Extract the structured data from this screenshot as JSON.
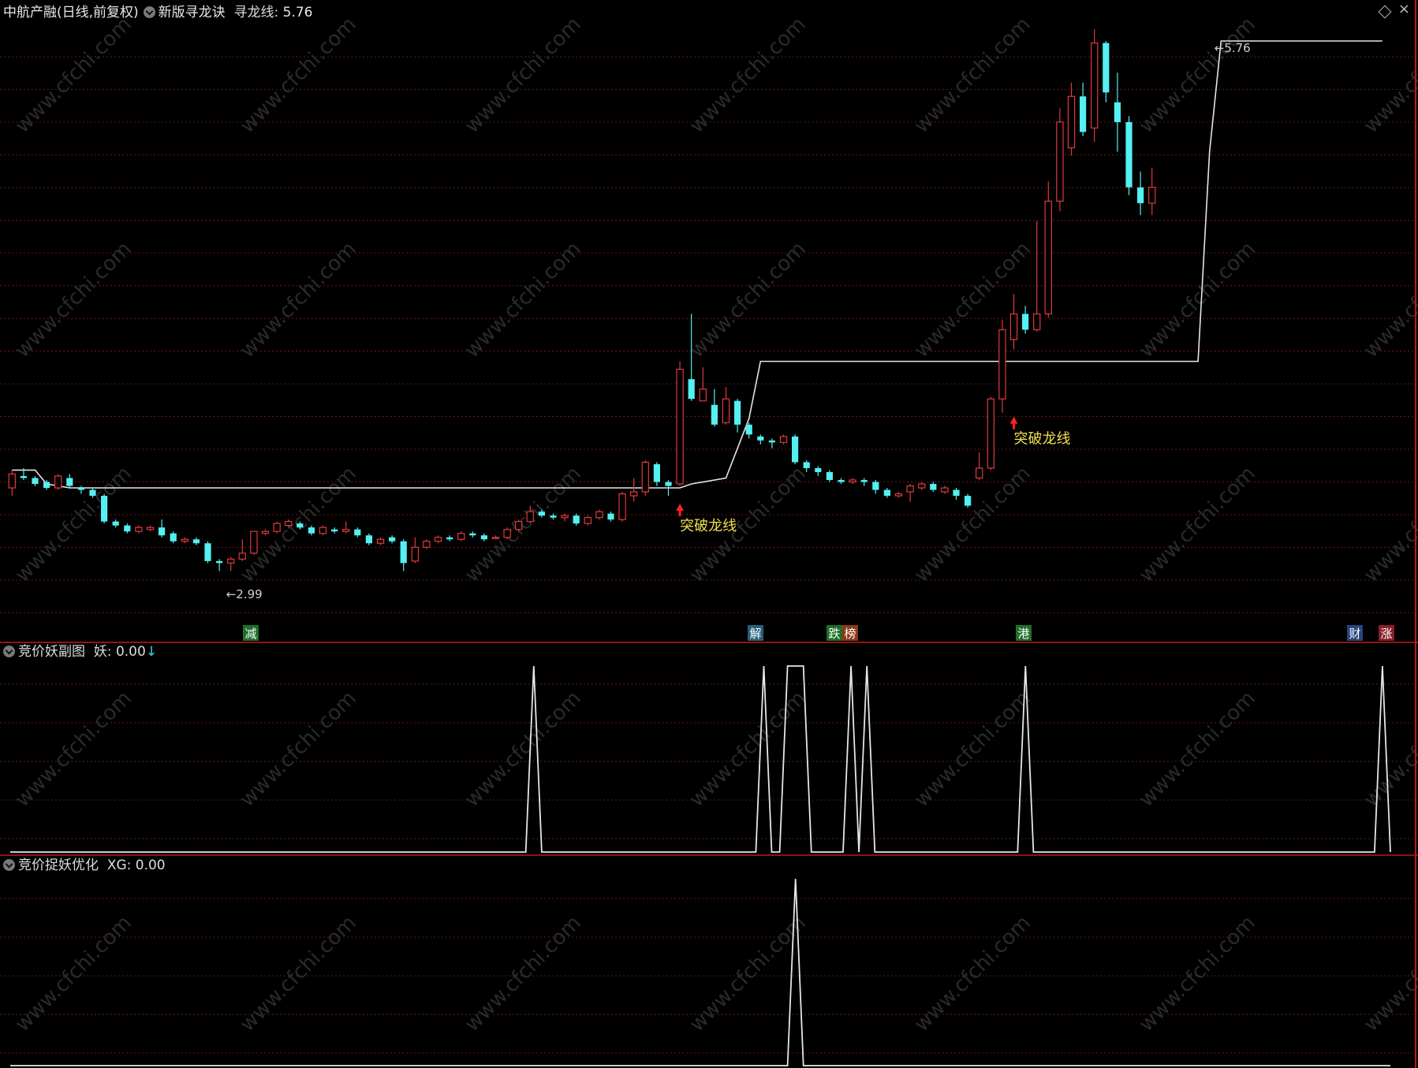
{
  "colors": {
    "background": "#000000",
    "up": "#e0393c",
    "down": "#54f0f2",
    "grid": "#6e1414",
    "border": "#c01818",
    "line": "#e6e6e6",
    "signal_text": "#f0e050",
    "signal_arrow": "#ff2020"
  },
  "main_panel": {
    "stock_title": "中航产融(日线,前复权)",
    "indicator_name": "新版寻龙诀",
    "line_label": "寻龙线:",
    "line_value": "5.76",
    "max_label": "5.76",
    "min_label": "2.99"
  },
  "sub_panel_1": {
    "name": "竞价妖副图",
    "value_label": "妖:",
    "value": "0.00"
  },
  "sub_panel_2": {
    "name": "竞价捉妖优化",
    "value_label": "XG:",
    "value": "0.00"
  },
  "icons": [
    "indicator-toggle-icon",
    "diamond-icon",
    "close-icon",
    "down-arrow-icon"
  ],
  "chart_data": {
    "type": "candlestick",
    "n": 120,
    "ylim": [
      2.95,
      5.8
    ],
    "candles": [
      [
        3.5,
        3.57,
        3.59,
        3.46
      ],
      [
        3.56,
        3.55,
        3.6,
        3.54
      ],
      [
        3.55,
        3.52,
        3.56,
        3.51
      ],
      [
        3.53,
        3.5,
        3.54,
        3.49
      ],
      [
        3.5,
        3.56,
        3.57,
        3.49
      ],
      [
        3.55,
        3.51,
        3.57,
        3.5
      ],
      [
        3.5,
        3.49,
        3.51,
        3.47
      ],
      [
        3.49,
        3.46,
        3.5,
        3.45
      ],
      [
        3.46,
        3.33,
        3.47,
        3.32
      ],
      [
        3.33,
        3.31,
        3.34,
        3.3
      ],
      [
        3.31,
        3.28,
        3.32,
        3.27
      ],
      [
        3.28,
        3.3,
        3.31,
        3.27
      ],
      [
        3.29,
        3.3,
        3.31,
        3.28
      ],
      [
        3.3,
        3.26,
        3.34,
        3.25
      ],
      [
        3.27,
        3.23,
        3.28,
        3.22
      ],
      [
        3.23,
        3.24,
        3.25,
        3.22
      ],
      [
        3.24,
        3.22,
        3.25,
        3.21
      ],
      [
        3.22,
        3.13,
        3.23,
        3.12
      ],
      [
        3.13,
        3.12,
        3.14,
        3.08
      ],
      [
        3.12,
        3.14,
        3.15,
        3.08
      ],
      [
        3.14,
        3.17,
        3.24,
        3.13
      ],
      [
        3.17,
        3.28,
        3.28,
        3.16
      ],
      [
        3.27,
        3.28,
        3.29,
        3.26
      ],
      [
        3.28,
        3.32,
        3.33,
        3.27
      ],
      [
        3.31,
        3.33,
        3.34,
        3.3
      ],
      [
        3.32,
        3.3,
        3.33,
        3.29
      ],
      [
        3.3,
        3.27,
        3.31,
        3.26
      ],
      [
        3.27,
        3.3,
        3.31,
        3.26
      ],
      [
        3.29,
        3.28,
        3.3,
        3.27
      ],
      [
        3.28,
        3.29,
        3.33,
        3.27
      ],
      [
        3.29,
        3.26,
        3.3,
        3.25
      ],
      [
        3.26,
        3.22,
        3.27,
        3.21
      ],
      [
        3.22,
        3.24,
        3.25,
        3.21
      ],
      [
        3.25,
        3.23,
        3.26,
        3.22
      ],
      [
        3.23,
        3.12,
        3.24,
        3.08
      ],
      [
        3.13,
        3.2,
        3.25,
        3.12
      ],
      [
        3.2,
        3.23,
        3.24,
        3.19
      ],
      [
        3.23,
        3.25,
        3.26,
        3.22
      ],
      [
        3.25,
        3.24,
        3.26,
        3.23
      ],
      [
        3.24,
        3.27,
        3.28,
        3.23
      ],
      [
        3.27,
        3.26,
        3.28,
        3.25
      ],
      [
        3.26,
        3.24,
        3.27,
        3.23
      ],
      [
        3.25,
        3.25,
        3.26,
        3.24
      ],
      [
        3.25,
        3.29,
        3.3,
        3.24
      ],
      [
        3.29,
        3.33,
        3.34,
        3.28
      ],
      [
        3.33,
        3.38,
        3.41,
        3.32
      ],
      [
        3.38,
        3.36,
        3.39,
        3.35
      ],
      [
        3.36,
        3.35,
        3.37,
        3.34
      ],
      [
        3.35,
        3.36,
        3.37,
        3.33
      ],
      [
        3.36,
        3.32,
        3.37,
        3.31
      ],
      [
        3.32,
        3.35,
        3.36,
        3.31
      ],
      [
        3.35,
        3.38,
        3.39,
        3.34
      ],
      [
        3.37,
        3.34,
        3.38,
        3.33
      ],
      [
        3.34,
        3.47,
        3.48,
        3.33
      ],
      [
        3.46,
        3.48,
        3.55,
        3.43
      ],
      [
        3.48,
        3.63,
        3.64,
        3.46
      ],
      [
        3.62,
        3.53,
        3.63,
        3.51
      ],
      [
        3.53,
        3.51,
        3.54,
        3.46
      ],
      [
        3.52,
        4.1,
        4.14,
        3.51
      ],
      [
        4.05,
        3.95,
        4.38,
        3.94
      ],
      [
        3.94,
        4.0,
        4.11,
        3.95
      ],
      [
        3.92,
        3.82,
        4.0,
        3.81
      ],
      [
        3.83,
        3.95,
        4.01,
        3.82
      ],
      [
        3.94,
        3.82,
        3.95,
        3.78
      ],
      [
        3.82,
        3.77,
        3.83,
        3.75
      ],
      [
        3.76,
        3.74,
        3.77,
        3.72
      ],
      [
        3.74,
        3.73,
        3.75,
        3.7
      ],
      [
        3.73,
        3.76,
        3.77,
        3.72
      ],
      [
        3.76,
        3.63,
        3.77,
        3.62
      ],
      [
        3.63,
        3.6,
        3.64,
        3.58
      ],
      [
        3.6,
        3.58,
        3.61,
        3.56
      ],
      [
        3.58,
        3.54,
        3.59,
        3.53
      ],
      [
        3.54,
        3.53,
        3.55,
        3.52
      ],
      [
        3.53,
        3.54,
        3.55,
        3.52
      ],
      [
        3.54,
        3.53,
        3.55,
        3.51
      ],
      [
        3.53,
        3.49,
        3.54,
        3.47
      ],
      [
        3.49,
        3.46,
        3.5,
        3.45
      ],
      [
        3.46,
        3.47,
        3.48,
        3.45
      ],
      [
        3.48,
        3.51,
        3.52,
        3.43
      ],
      [
        3.5,
        3.52,
        3.53,
        3.49
      ],
      [
        3.52,
        3.49,
        3.53,
        3.48
      ],
      [
        3.48,
        3.5,
        3.51,
        3.47
      ],
      [
        3.49,
        3.46,
        3.5,
        3.44
      ],
      [
        3.46,
        3.41,
        3.47,
        3.4
      ],
      [
        3.55,
        3.6,
        3.68,
        3.54
      ],
      [
        3.6,
        3.95,
        3.96,
        3.59
      ],
      [
        3.95,
        4.3,
        4.35,
        3.88
      ],
      [
        4.25,
        4.38,
        4.48,
        4.2
      ],
      [
        4.38,
        4.3,
        4.42,
        4.28
      ],
      [
        4.3,
        4.38,
        4.85,
        4.29
      ],
      [
        4.38,
        4.95,
        5.05,
        4.36
      ],
      [
        4.95,
        5.35,
        5.42,
        4.9
      ],
      [
        5.22,
        5.48,
        5.55,
        5.18
      ],
      [
        5.48,
        5.3,
        5.55,
        5.28
      ],
      [
        5.32,
        5.75,
        5.82,
        5.25
      ],
      [
        5.75,
        5.5,
        5.76,
        5.45
      ],
      [
        5.45,
        5.35,
        5.6,
        5.2
      ],
      [
        5.35,
        5.02,
        5.38,
        4.98
      ],
      [
        5.02,
        4.94,
        5.1,
        4.88
      ],
      [
        4.94,
        5.02,
        5.12,
        4.88
      ]
    ],
    "line_points": [
      [
        0,
        3.59
      ],
      [
        2,
        3.59
      ],
      [
        3,
        3.52
      ],
      [
        5,
        3.5
      ],
      [
        58,
        3.5
      ],
      [
        59,
        3.52
      ],
      [
        62,
        3.55
      ],
      [
        64,
        3.85
      ],
      [
        65,
        4.14
      ],
      [
        103,
        4.14
      ],
      [
        104,
        5.2
      ],
      [
        105,
        5.76
      ],
      [
        119,
        5.76
      ]
    ],
    "max_marker": {
      "index": 104,
      "value": 5.76
    },
    "min_marker": {
      "index": 19,
      "value": 2.99
    },
    "signals": [
      {
        "index": 58,
        "value": 3.46,
        "label": "突破龙线"
      },
      {
        "index": 87,
        "value": 3.9,
        "label": "突破龙线"
      }
    ],
    "event_tags": [
      {
        "index": 30,
        "text": "减",
        "bg": "#1f6e2a"
      },
      {
        "index": 94,
        "text": "解",
        "bg": "#2a5e7a"
      },
      {
        "index": 104,
        "text": "跌",
        "bg": "#1f6e2a"
      },
      {
        "index": 106,
        "text": "榜",
        "bg": "#8a3a1a"
      },
      {
        "index": 128,
        "text": "港",
        "bg": "#1f6e2a"
      },
      {
        "index": 170,
        "text": "财",
        "bg": "#25457a"
      },
      {
        "index": 174,
        "text": "涨",
        "bg": "#8a1e2a"
      }
    ],
    "sub1_series": [
      0,
      0,
      0,
      0,
      0,
      0,
      0,
      0,
      0,
      0,
      0,
      0,
      0,
      0,
      0,
      0,
      0,
      0,
      0,
      0,
      0,
      0,
      0,
      0,
      0,
      0,
      0,
      0,
      0,
      0,
      0,
      0,
      0,
      0,
      0,
      0,
      0,
      0,
      0,
      0,
      0,
      0,
      0,
      0,
      0,
      0,
      0,
      0,
      0,
      0,
      0,
      0,
      0,
      0,
      0,
      0,
      0,
      0,
      0,
      0,
      0,
      0,
      0,
      0,
      0,
      0,
      1,
      0,
      0,
      0,
      0,
      0,
      0,
      0,
      0,
      0,
      0,
      0,
      0,
      0,
      0,
      0,
      0,
      0,
      0,
      0,
      0,
      0,
      0,
      0,
      0,
      0,
      0,
      0,
      0,
      1,
      0,
      0,
      1,
      1,
      1,
      0,
      0,
      0,
      0,
      0,
      1,
      0,
      1,
      0,
      0,
      0,
      0,
      0,
      0,
      0,
      0,
      0,
      0,
      0,
      0,
      0,
      0,
      0,
      0,
      0,
      0,
      0,
      1,
      0,
      0,
      0,
      0,
      0,
      0,
      0,
      0,
      0,
      0,
      0,
      0,
      0,
      0,
      0,
      0,
      0,
      0,
      0,
      0,
      0,
      0,
      0,
      0,
      0,
      0,
      0,
      0,
      0,
      0,
      0,
      0,
      0,
      0,
      0,
      0,
      0,
      0,
      0,
      0,
      0,
      0,
      0,
      0,
      1,
      0
    ],
    "sub2_series": [
      0,
      0,
      0,
      0,
      0,
      0,
      0,
      0,
      0,
      0,
      0,
      0,
      0,
      0,
      0,
      0,
      0,
      0,
      0,
      0,
      0,
      0,
      0,
      0,
      0,
      0,
      0,
      0,
      0,
      0,
      0,
      0,
      0,
      0,
      0,
      0,
      0,
      0,
      0,
      0,
      0,
      0,
      0,
      0,
      0,
      0,
      0,
      0,
      0,
      0,
      0,
      0,
      0,
      0,
      0,
      0,
      0,
      0,
      0,
      0,
      0,
      0,
      0,
      0,
      0,
      0,
      0,
      0,
      0,
      0,
      0,
      0,
      0,
      0,
      0,
      0,
      0,
      0,
      0,
      0,
      0,
      0,
      0,
      0,
      0,
      0,
      0,
      0,
      0,
      0,
      0,
      0,
      0,
      0,
      0,
      0,
      0,
      0,
      0,
      1,
      0,
      0,
      0,
      0,
      0,
      0,
      0,
      0,
      0,
      0,
      0,
      0,
      0,
      0,
      0,
      0,
      0,
      0,
      0,
      0,
      0,
      0,
      0,
      0,
      0,
      0,
      0,
      0,
      0,
      0,
      0,
      0,
      0,
      0,
      0,
      0,
      0,
      0,
      0,
      0,
      0,
      0,
      0,
      0,
      0,
      0,
      0,
      0,
      0,
      0,
      0,
      0,
      0,
      0,
      0,
      0,
      0,
      0,
      0,
      0,
      0,
      0,
      0,
      0,
      0,
      0,
      0,
      0,
      0,
      0,
      0,
      0,
      0,
      0,
      0
    ]
  }
}
